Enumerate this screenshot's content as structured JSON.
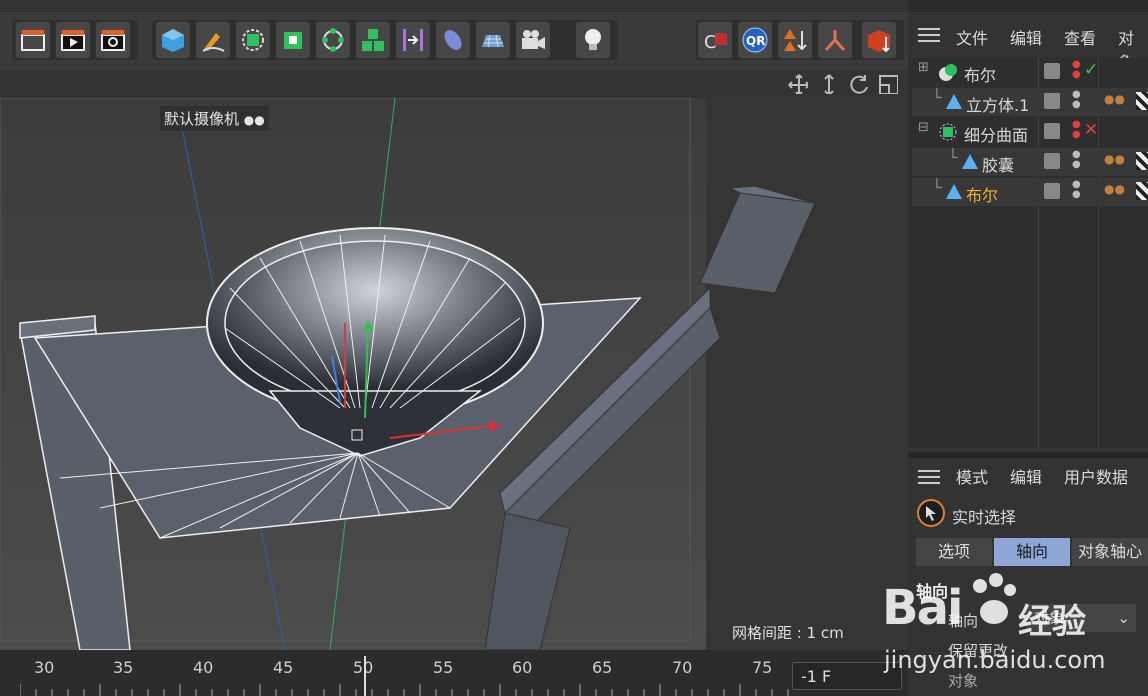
{
  "toolbar": {
    "left_icons": [
      "film-clapper-icon",
      "render-play-icon",
      "render-settings-icon"
    ],
    "center_icons": [
      "cube-icon",
      "pen-icon",
      "subdivide-icon",
      "box-icon",
      "cloner-icon",
      "array-cubes-icon",
      "align-icon",
      "deformer-icon",
      "floor-grid-icon",
      "camera-icon",
      "light-bulb-icon"
    ],
    "right_icons": [
      "magnet-c-icon",
      "qr-icon",
      "triangle-arrows-icon",
      "joint-icon",
      "box-arrow-icon"
    ]
  },
  "viewport": {
    "camera_label": "默认摄像机",
    "grid_spacing": "网格间距 : 1 cm"
  },
  "timeline": {
    "ticks": [
      "30",
      "35",
      "40",
      "45",
      "50",
      "55",
      "60",
      "65",
      "70",
      "75"
    ],
    "frame_value": "-1 F"
  },
  "object_manager": {
    "menu": [
      "文件",
      "编辑",
      "查看",
      "对象"
    ],
    "rows": [
      {
        "name": "布尔",
        "icon": "boolean-icon",
        "indent": 0,
        "status": "check",
        "selected": false
      },
      {
        "name": "立方体.1",
        "icon": "cube-object-icon",
        "indent": 1,
        "status": "none",
        "selected": false
      },
      {
        "name": "细分曲面",
        "icon": "subdivision-icon",
        "indent": 0,
        "status": "cross",
        "selected": false
      },
      {
        "name": "胶囊",
        "icon": "capsule-object-icon",
        "indent": 2,
        "status": "none",
        "selected": false
      },
      {
        "name": "布尔",
        "icon": "boolean-object-icon",
        "indent": 1,
        "status": "none",
        "selected": true
      }
    ]
  },
  "attribute_manager": {
    "menu": [
      "模式",
      "编辑",
      "用户数据"
    ],
    "tool": "实时选择",
    "tabs": [
      "选项",
      "轴向",
      "对象轴心"
    ],
    "active_tab": "轴向",
    "section": "轴向",
    "axis_label": "轴向",
    "axis_value": "对象",
    "keep_change": "保留更改",
    "object_label": "对象"
  },
  "watermark": {
    "brand": "Bai",
    "brand2": "经验",
    "url": "jingyan.baidu.com"
  },
  "colors": {
    "accent": "#8fa7d6",
    "selected_text": "#f0b030",
    "check": "#3cc83c",
    "cross": "#e04040"
  }
}
